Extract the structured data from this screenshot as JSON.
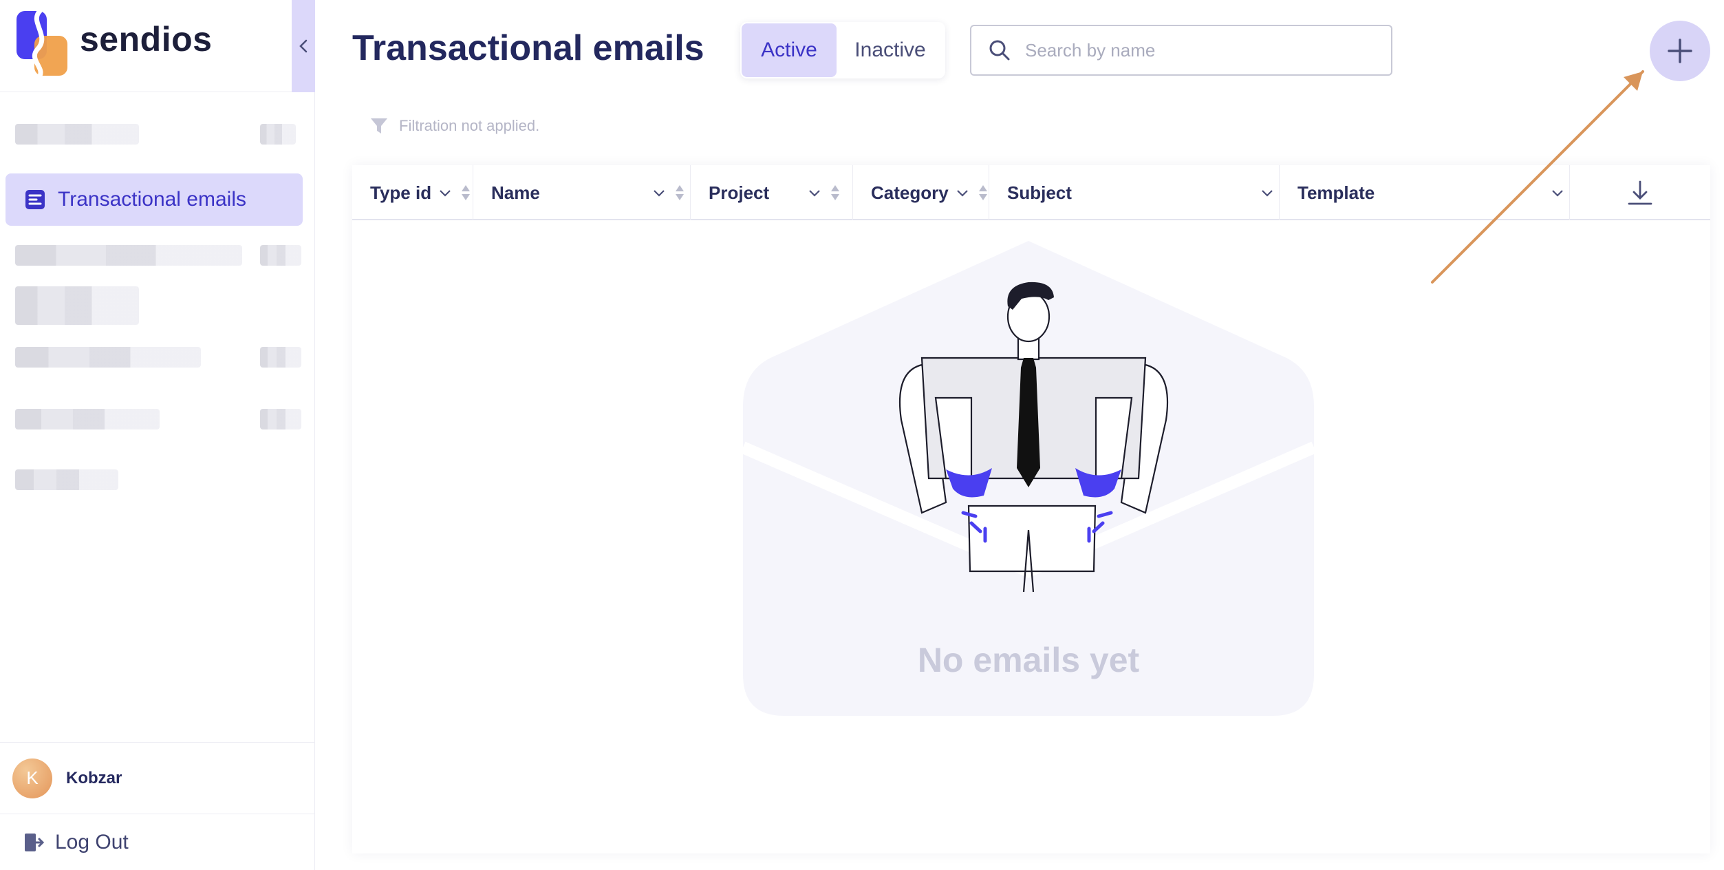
{
  "app": {
    "brand": "sendios"
  },
  "sidebar": {
    "active_item": "Transactional emails"
  },
  "user": {
    "initial": "K",
    "name": "Kobzar",
    "logout_label": "Log Out"
  },
  "header": {
    "title": "Transactional emails",
    "tabs": [
      "Active",
      "Inactive"
    ],
    "search_placeholder": "Search by name"
  },
  "filter": {
    "status_text": "Filtration not applied."
  },
  "table": {
    "columns": [
      "Type id",
      "Name",
      "Project",
      "Category",
      "Subject",
      "Template"
    ]
  },
  "empty_state": {
    "text": "No emails yet"
  },
  "colors": {
    "accent": "#3b33c6",
    "accent_light": "#dcd8fa",
    "title": "#23285e",
    "annotation_arrow": "#d9955a"
  },
  "icons": [
    "logo-mark",
    "chevron-left-icon",
    "email-list-icon",
    "logout-icon",
    "search-icon",
    "plus-icon",
    "filter-icon",
    "chevron-down-icon",
    "sort-icon",
    "download-icon"
  ]
}
